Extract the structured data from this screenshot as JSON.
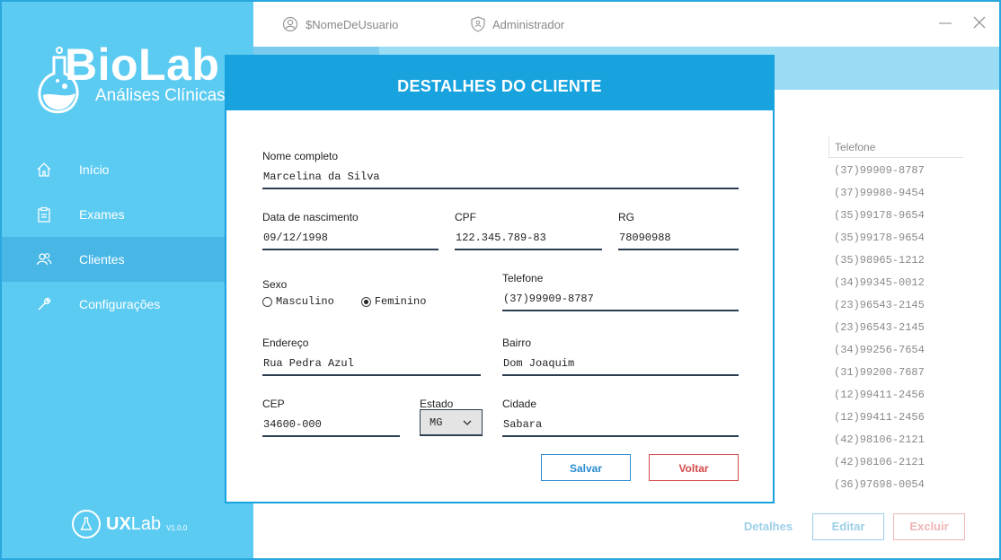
{
  "app": {
    "logo_title": "BioLab",
    "logo_subtitle": "Análises Clínicas",
    "footer_brand_bold": "UX",
    "footer_brand": "Lab",
    "footer_version": "V1.0.0"
  },
  "topbar": {
    "username": "$NomeDeUsuario",
    "role": "Administrador"
  },
  "sidebar": {
    "items": [
      {
        "label": "Início",
        "icon": "home-icon"
      },
      {
        "label": "Exames",
        "icon": "clipboard-icon"
      },
      {
        "label": "Clientes",
        "icon": "users-icon",
        "active": true
      },
      {
        "label": "Configurações",
        "icon": "wrench-icon"
      }
    ]
  },
  "background_table": {
    "column_header": "Telefone",
    "phones": [
      "(37)99909-8787",
      "(37)99980-9454",
      "(35)99178-9654",
      "(35)99178-9654",
      "(35)98965-1212",
      "(34)99345-0012",
      "(23)96543-2145",
      "(23)96543-2145",
      "(34)99256-7654",
      "(31)99200-7687",
      "(12)99411-2456",
      "(12)99411-2456",
      "(42)98106-2121",
      "(42)98106-2121",
      "(36)97698-0054"
    ],
    "actions": {
      "details": "Detalhes",
      "edit": "Editar",
      "delete": "Excluir"
    }
  },
  "modal": {
    "title": "DESTALHES DO CLIENTE",
    "fields": {
      "nome": {
        "label": "Nome completo",
        "value": "Marcelina da Silva"
      },
      "nascimento": {
        "label": "Data de nascimento",
        "value": "09/12/1998"
      },
      "cpf": {
        "label": "CPF",
        "value": "122.345.789-83"
      },
      "rg": {
        "label": "RG",
        "value": "78090988"
      },
      "sexo": {
        "label": "Sexo",
        "options": [
          "Masculino",
          "Feminino"
        ],
        "selected": "Feminino"
      },
      "telefone": {
        "label": "Telefone",
        "value": "(37)99909-8787"
      },
      "endereco": {
        "label": "Endereço",
        "value": "Rua Pedra Azul"
      },
      "bairro": {
        "label": "Bairro",
        "value": "Dom Joaquim"
      },
      "cep": {
        "label": "CEP",
        "value": "34600-000"
      },
      "estado": {
        "label": "Estado",
        "value": "MG"
      },
      "cidade": {
        "label": "Cidade",
        "value": "Sabara"
      }
    },
    "save_label": "Salvar",
    "back_label": "Voltar"
  },
  "colors": {
    "sidebar": "#5ccbf2",
    "sidebar_active": "#48b7e6",
    "primary": "#18a3df",
    "save": "#2b8cd0",
    "cancel": "#d24a4a"
  }
}
